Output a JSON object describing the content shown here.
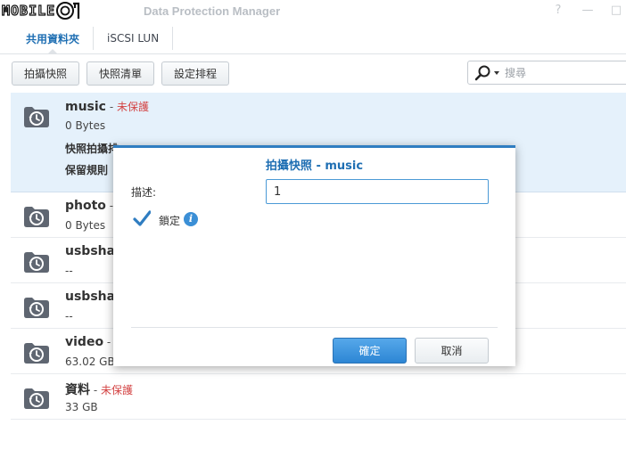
{
  "window": {
    "logo_text": "MOBILE",
    "logo_mark": "01",
    "title": "Data Protection Manager",
    "help_glyph": "?",
    "minimize_glyph": "—",
    "maximize_glyph": "□"
  },
  "tabs": [
    {
      "label": "共用資料夾",
      "active": true
    },
    {
      "label": "iSCSI LUN",
      "active": false
    }
  ],
  "toolbar": {
    "take_snapshot": "拍攝快照",
    "snapshot_list": "快照清單",
    "set_schedule": "設定排程",
    "search_placeholder": "搜尋"
  },
  "rows": [
    {
      "name": "music",
      "sep": " - ",
      "status": "未保護",
      "size": "0 Bytes",
      "detail1": "快照拍攝排",
      "detail2": "保留規則"
    },
    {
      "name": "photo",
      "sep": " -",
      "status": "",
      "size": "0 Bytes"
    },
    {
      "name": "usbsha",
      "sep": "",
      "status": "",
      "size": "--"
    },
    {
      "name": "usbsha",
      "sep": "",
      "status": "",
      "size": "--"
    },
    {
      "name": "video",
      "sep": " -",
      "status": "",
      "size": "63.02 GB"
    },
    {
      "name": "資料",
      "sep": " - ",
      "status": "未保護",
      "size": "33 GB"
    }
  ],
  "dialog": {
    "title": "拍攝快照 - music",
    "description_label": "描述:",
    "description_value": "1",
    "lock_label": "鎖定",
    "lock_checked": true,
    "info_glyph": "i",
    "ok": "確定",
    "cancel": "取消"
  },
  "colors": {
    "accent": "#1f6fb3",
    "status_unprotected": "#d34343",
    "selected_row": "#e5f1fb"
  }
}
